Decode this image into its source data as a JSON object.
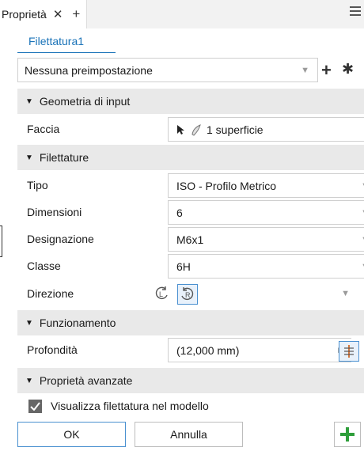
{
  "tabbar": {
    "title": "Proprietà",
    "close": "✕",
    "add": "+"
  },
  "feature": {
    "name": "Filettatura1"
  },
  "preset": {
    "value": "Nessuna preimpostazione"
  },
  "sections": {
    "input": "Geometria di input",
    "threads": "Filettature",
    "behavior": "Funzionamento",
    "advanced": "Proprietà avanzate"
  },
  "input": {
    "face_label": "Faccia",
    "face_value": "1 superficie"
  },
  "threads": {
    "type_label": "Tipo",
    "type_value": "ISO - Profilo  Metrico",
    "size_label": "Dimensioni",
    "size_value": "6",
    "designation_label": "Designazione",
    "designation_value": "M6x1",
    "class_label": "Classe",
    "class_value": "6H",
    "direction_label": "Direzione"
  },
  "behavior": {
    "depth_label": "Profondità",
    "depth_value": "(12,000 mm)"
  },
  "advanced": {
    "show_model_label": "Visualizza filettatura nel modello",
    "show_model_checked": true
  },
  "buttons": {
    "ok": "OK",
    "cancel": "Annulla"
  },
  "colors": {
    "accent": "#1a73b8",
    "add_green": "#2e9e3a"
  }
}
